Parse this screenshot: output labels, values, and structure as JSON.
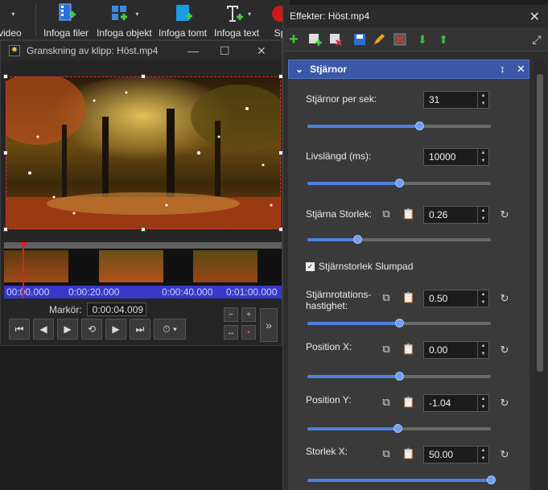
{
  "ribbon": {
    "items": [
      {
        "label": "a video",
        "icon": "video-icon"
      },
      {
        "label": "Infoga filer",
        "icon": "insert-files-icon"
      },
      {
        "label": "Infoga objekt",
        "icon": "insert-object-icon"
      },
      {
        "label": "Infoga tomt",
        "icon": "insert-blank-icon"
      },
      {
        "label": "Infoga text",
        "icon": "insert-text-icon"
      },
      {
        "label": "Sp",
        "icon": "record-icon"
      }
    ]
  },
  "preview": {
    "title": "Granskning av klipp: Höst.mp4",
    "ruler_ticks": [
      "00:00.000",
      "0:00:20.000",
      "0:00:40.000",
      "0:01:00.000"
    ],
    "marker_label": "Markör:",
    "marker_value": "0:00:04.009"
  },
  "effects": {
    "title": "Effekter: Höst.mp4",
    "group_title": "Stjärnor",
    "params": [
      {
        "label": "Stjärnor per sek:",
        "value": "31",
        "slider": 0.61
      },
      {
        "label": "Livslängd (ms):",
        "value": "10000",
        "slider": 0.5
      },
      {
        "label": "Stjärna Storlek:",
        "value": "0.26",
        "slider": 0.27
      },
      {
        "label": "Stjärnrotations-hastighet:",
        "value": "0.50",
        "slider": 0.5
      },
      {
        "label": "Position X:",
        "value": "0.00",
        "slider": 0.5
      },
      {
        "label": "Position Y:",
        "value": "-1.04",
        "slider": 0.49
      },
      {
        "label": "Storlek X:",
        "value": "50.00",
        "slider": 1.0
      }
    ],
    "checkbox_label": "Stjärnstorlek Slumpad",
    "checkbox_checked": true
  },
  "colors": {
    "accent": "#3a57a8",
    "slider": "#4f7fe0",
    "ruler": "#3838c8",
    "playhead": "#e02020"
  }
}
